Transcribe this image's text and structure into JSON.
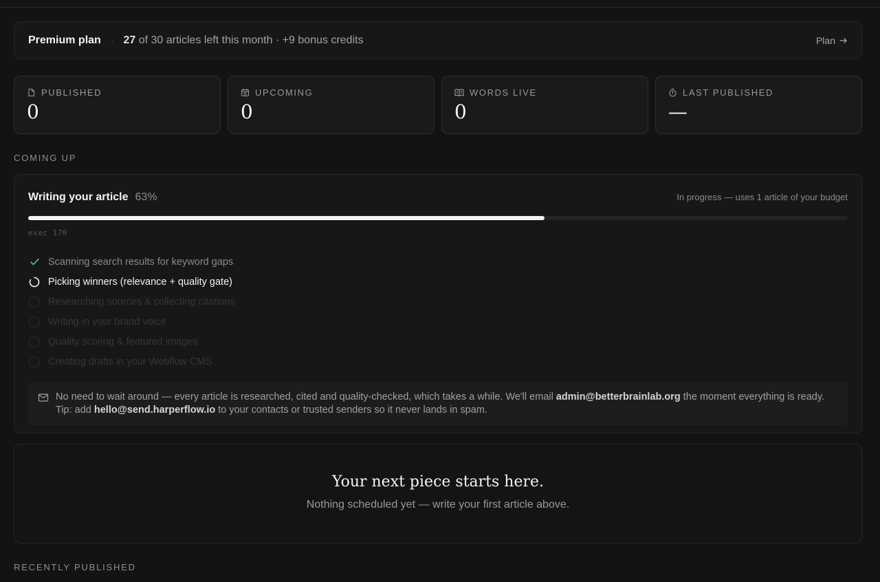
{
  "plan": {
    "name": "Premium plan",
    "used": "27",
    "usage_text": "of 30 articles left this month · +9 bonus credits",
    "link_label": "Plan"
  },
  "stats": [
    {
      "label": "PUBLISHED",
      "value": "0",
      "icon": "document-icon"
    },
    {
      "label": "UPCOMING",
      "value": "0",
      "icon": "calendar-clock-icon"
    },
    {
      "label": "WORDS LIVE",
      "value": "0",
      "icon": "open-book-icon"
    },
    {
      "label": "LAST PUBLISHED",
      "value": "—",
      "icon": "stopwatch-icon"
    }
  ],
  "coming_up": {
    "section_label": "COMING UP",
    "title": "Writing your article",
    "percent_label": "63%",
    "progress_fraction": 0.63,
    "note": "In progress — uses 1 article of your budget",
    "exec": "exec 170",
    "steps": [
      {
        "label": "Scanning search results for keyword gaps",
        "state": "done"
      },
      {
        "label": "Picking winners (relevance + quality gate)",
        "state": "active"
      },
      {
        "label": "Researching sources & collecting citations",
        "state": "pending"
      },
      {
        "label": "Writing in your brand voice",
        "state": "pending"
      },
      {
        "label": "Quality scoring & featured images",
        "state": "pending"
      },
      {
        "label": "Creating drafts in your Webflow CMS",
        "state": "pending"
      }
    ],
    "notice": {
      "part1": "No need to wait around — every article is researched, cited and quality-checked, which takes a while. We'll email ",
      "email1": "admin@betterbrainlab.org",
      "part2": " the moment everything is ready. Tip: add ",
      "email2": "hello@send.harperflow.io",
      "part3": " to your contacts or trusted senders so it never lands in spam."
    }
  },
  "empty_state": {
    "title": "Your next piece starts here.",
    "subtitle": "Nothing scheduled yet — write your first article above."
  },
  "recently_published": {
    "section_label": "RECENTLY PUBLISHED"
  },
  "colors": {
    "background": "#131313",
    "card": "#171717",
    "success": "#4ade80",
    "progress_fill": "#f2f2f2"
  }
}
